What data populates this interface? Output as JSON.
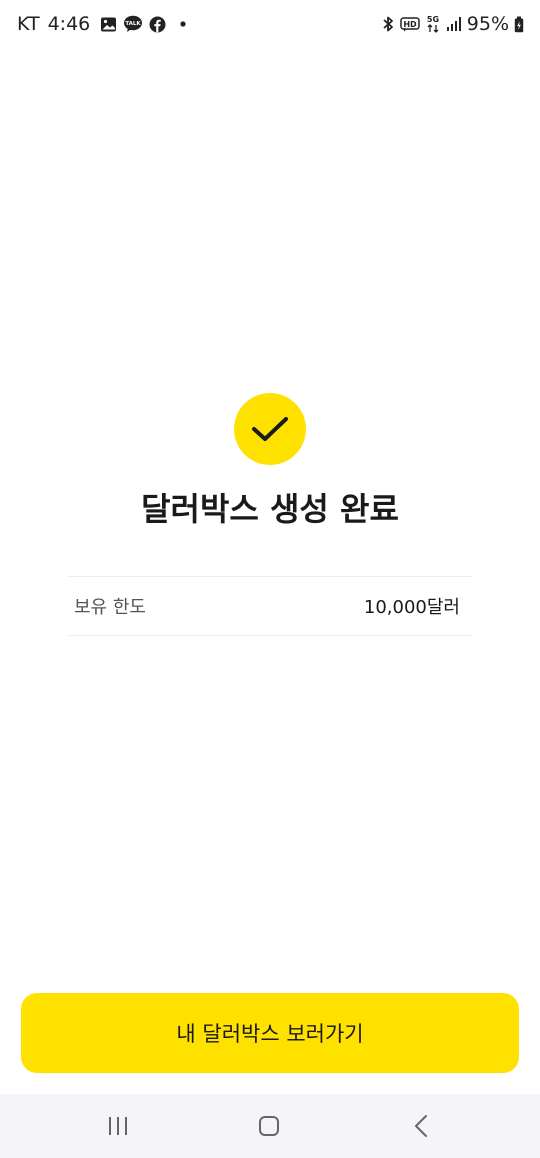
{
  "status_bar": {
    "carrier": "KT",
    "time": "4:46",
    "battery": "95%",
    "icons_left": [
      "gallery-icon",
      "kakaotalk-icon",
      "facebook-icon",
      "dot-icon"
    ],
    "icons_right": [
      "bluetooth-icon",
      "hd-icon",
      "5g-icon",
      "signal-icon",
      "battery-icon"
    ]
  },
  "completion": {
    "title": "달러박스 생성 완료",
    "rows": [
      {
        "label": "보유 한도",
        "value": "10,000달러"
      }
    ]
  },
  "cta": {
    "label": "내 달러박스 보러가기"
  },
  "colors": {
    "accent": "#FFE100",
    "text": "#1a1a1a",
    "subtext": "#555555",
    "nav_bg": "#f4f4f9"
  }
}
